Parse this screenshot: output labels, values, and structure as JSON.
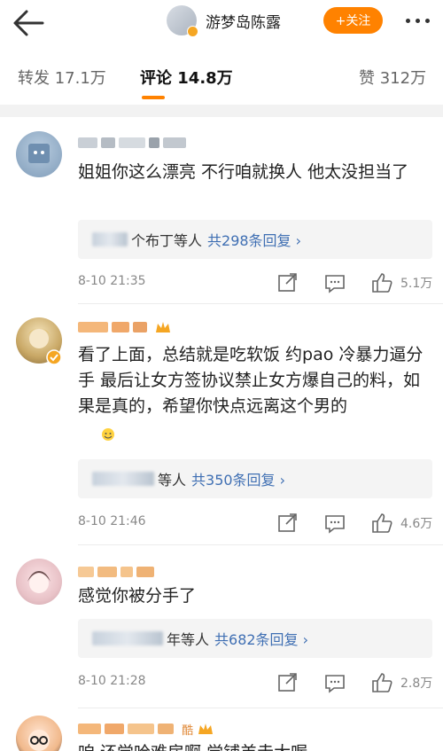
{
  "header": {
    "profile_name": "游梦岛陈露",
    "follow_label": "+关注"
  },
  "tabs": [
    {
      "label": "转发 17.1万"
    },
    {
      "label": "评论 14.8万"
    },
    {
      "label": "赞 312万"
    }
  ],
  "comments": [
    {
      "text": "姐姐你这么漂亮 不行咱就换人 他太没担当了",
      "reply_names": "个布丁等人",
      "reply_link": "共298条回复 ›",
      "time": "8-10 21:35",
      "likes": "5.1万"
    },
    {
      "text": "看了上面，总结就是吃软饭 约pao 冷暴力逼分手 最后让女方签协议禁止女方爆自己的料，如果是真的，希望你快点远离这个男的",
      "reply_names": "等人",
      "reply_link": "共350条回复 ›",
      "time": "8-10 21:46",
      "likes": "4.6万"
    },
    {
      "text": "感觉你被分手了",
      "reply_names": "年等人",
      "reply_link": "共682条回复 ›",
      "time": "8-10 21:28",
      "likes": "2.8万"
    },
    {
      "text": "咱 还觉哈难房啊 觉铺羔走大喔",
      "name_partial": "酷"
    }
  ],
  "colors": {
    "accent": "#ff8200",
    "link": "#3f6fb3"
  }
}
